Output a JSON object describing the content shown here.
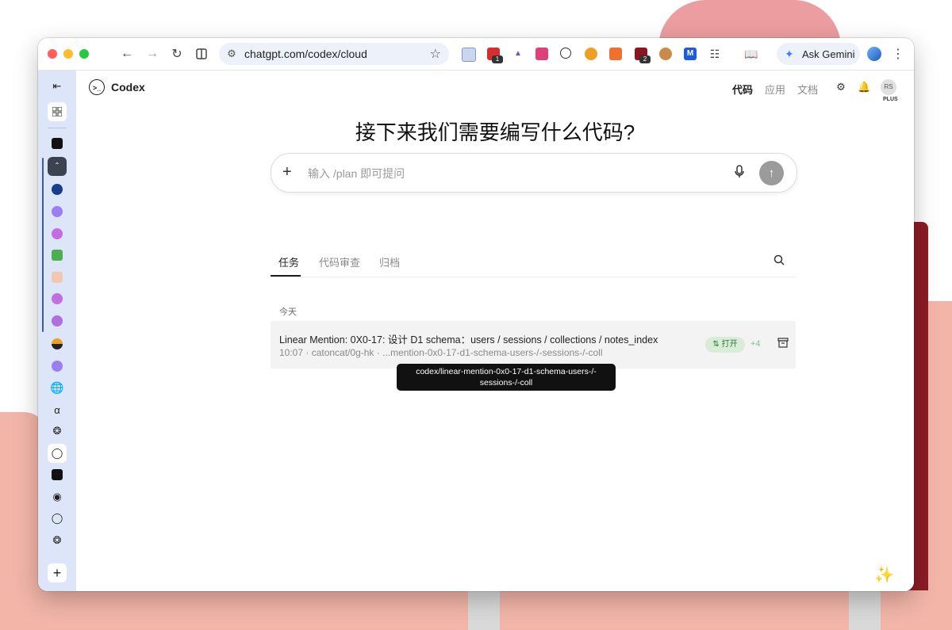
{
  "browser": {
    "url": "chatgpt.com/codex/cloud",
    "ask_gemini_label": "Ask Gemini",
    "extension_badges": [
      "1",
      "2"
    ]
  },
  "app": {
    "name": "Codex",
    "nav": {
      "code": "代码",
      "apps": "应用",
      "docs": "文档"
    },
    "avatar_initials": "RS",
    "plan_label": "PLUS"
  },
  "main": {
    "heading": "接下来我们需要编写什么代码?",
    "prompt_placeholder": "输入 /plan 即可提问",
    "tabs": [
      {
        "label": "任务",
        "active": true
      },
      {
        "label": "代码审查",
        "active": false
      },
      {
        "label": "归档",
        "active": false
      }
    ],
    "section_today": "今天",
    "tasks": [
      {
        "title": "Linear Mention: 0X0-17: 设计 D1 schema：users / sessions / collections / notes_index",
        "meta": "10:07 · catoncat/0g-hk · ...mention-0x0-17-d1-schema-users-/-sessions-/-coll",
        "status_label": "打开",
        "diff_count": "+4",
        "tooltip": "codex/linear-mention-0x0-17-d1-schema-users-/-sessions-/-coll"
      }
    ]
  },
  "colors": {
    "tabstrip_bg": "#dde6f8",
    "status_green": "#2f7a3a",
    "send_button": "#9b9b9b"
  }
}
